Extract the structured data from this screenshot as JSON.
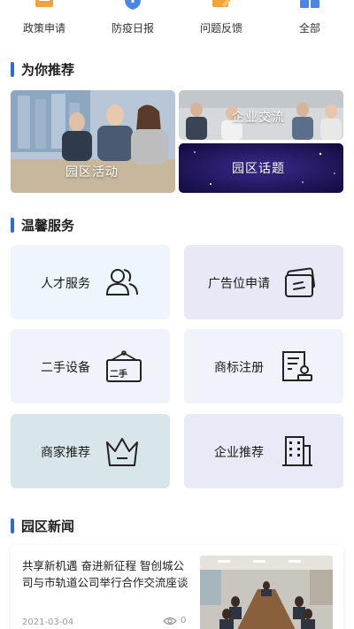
{
  "quick_menu": [
    {
      "label": "政策申请",
      "icon": "document-list-icon"
    },
    {
      "label": "防疫日报",
      "icon": "shield-plus-icon"
    },
    {
      "label": "问题反馈",
      "icon": "edit-feedback-icon"
    },
    {
      "label": "全部",
      "icon": "grid-all-icon"
    }
  ],
  "recommend": {
    "title": "为你推荐",
    "cards": [
      {
        "label": "园区活动"
      },
      {
        "label": "企业交流"
      },
      {
        "label": "园区话题"
      }
    ]
  },
  "services": {
    "title": "温馨服务",
    "items": [
      {
        "label": "人才服务",
        "icon": "people-icon"
      },
      {
        "label": "广告位申请",
        "icon": "ad-card-icon"
      },
      {
        "label": "二手设备",
        "icon": "secondhand-sign-icon",
        "icon_text": "二手"
      },
      {
        "label": "商标注册",
        "icon": "trademark-doc-icon"
      },
      {
        "label": "商家推荐",
        "icon": "crown-icon"
      },
      {
        "label": "企业推荐",
        "icon": "building-icon"
      }
    ]
  },
  "news": {
    "title": "园区新闻",
    "items": [
      {
        "title": "共享新机遇 奋进新征程 智创城公司与市轨道公司举行合作交流座谈",
        "date": "2021-03-04",
        "views": "0"
      }
    ]
  },
  "colors": {
    "accent": "#2f6bd8",
    "tile_blue_light": "#eef5fd",
    "tile_lavender": "#e9e8f6",
    "tile_light": "#f1f3fb",
    "tile_teal": "#d8e6ea",
    "tile_indigo": "#e8eaf8"
  }
}
